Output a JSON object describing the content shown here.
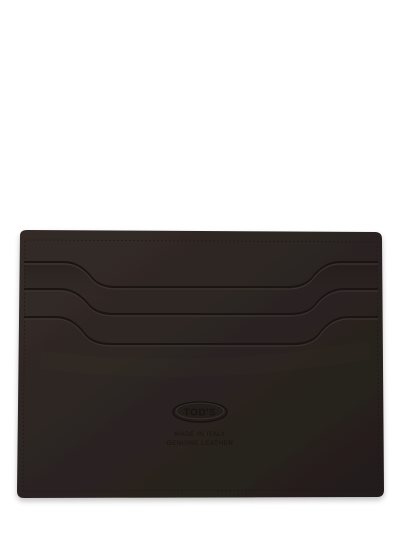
{
  "image": {
    "background_color": "#ffffff",
    "subject": "card-holder-wallet",
    "leather_color": "#2b2421",
    "leather_highlight": "#3a312c",
    "stitch_color": "#1c1715"
  },
  "emboss": {
    "logo_text": "TOD'S",
    "origin_text": "MADE IN ITALY",
    "material_text": "GENUINE LEATHER"
  }
}
